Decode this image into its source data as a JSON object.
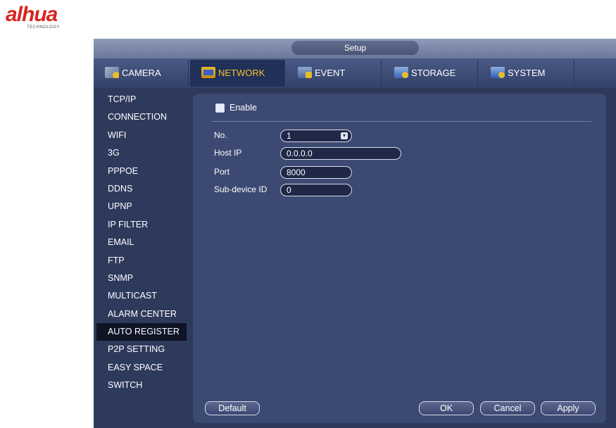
{
  "brand": {
    "logo_text": "alhua",
    "logo_subtext": "TECHNOLOGY",
    "color": "#d7261f"
  },
  "window": {
    "title": "Setup"
  },
  "tabs": [
    {
      "label": "CAMERA",
      "icon": "camera-icon"
    },
    {
      "label": "NETWORK",
      "icon": "network-icon",
      "active": true
    },
    {
      "label": "EVENT",
      "icon": "event-icon"
    },
    {
      "label": "STORAGE",
      "icon": "storage-icon"
    },
    {
      "label": "SYSTEM",
      "icon": "system-icon"
    }
  ],
  "sidemenu": {
    "items": [
      "TCP/IP",
      "CONNECTION",
      "WIFI",
      "3G",
      "PPPOE",
      "DDNS",
      "UPNP",
      "IP FILTER",
      "EMAIL",
      "FTP",
      "SNMP",
      "MULTICAST",
      "ALARM CENTER",
      "AUTO REGISTER",
      "P2P SETTING",
      "EASY SPACE",
      "SWITCH"
    ],
    "active": "AUTO REGISTER"
  },
  "form": {
    "enable_label": "Enable",
    "enable_checked": false,
    "no_label": "No.",
    "no_value": "1",
    "host_ip_label": "Host IP",
    "host_ip_value": "0.0.0.0",
    "port_label": "Port",
    "port_value": "8000",
    "sub_device_label": "Sub-device ID",
    "sub_device_value": "0"
  },
  "buttons": {
    "default_label": "Default",
    "ok_label": "OK",
    "cancel_label": "Cancel",
    "apply_label": "Apply"
  },
  "colors": {
    "window_bg": "#2e3a5c",
    "active_tab_text": "#f3c12a",
    "active_menu_bg": "#0e1426"
  }
}
